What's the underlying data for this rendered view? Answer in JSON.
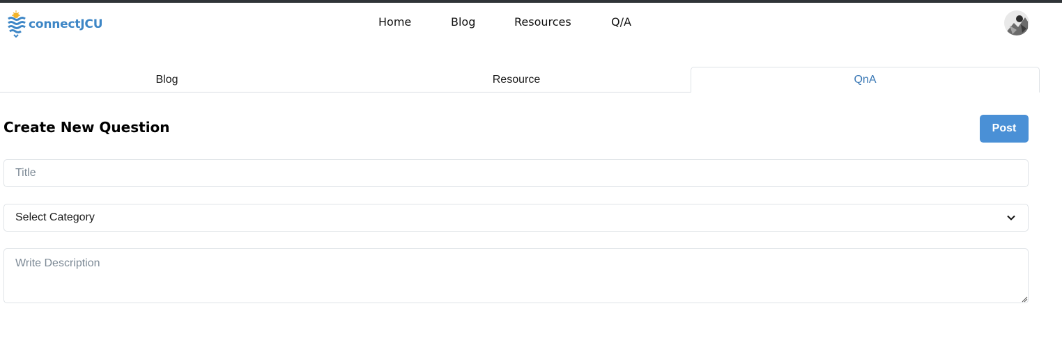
{
  "brand": {
    "name": "connectJCU",
    "accent": "#3d86c6"
  },
  "nav": [
    {
      "label": "Home"
    },
    {
      "label": "Blog"
    },
    {
      "label": "Resources"
    },
    {
      "label": "Q/A"
    }
  ],
  "tabs": [
    {
      "label": "Blog",
      "active": false
    },
    {
      "label": "Resource",
      "active": false
    },
    {
      "label": "QnA",
      "active": true
    }
  ],
  "form": {
    "heading": "Create New Question",
    "post_label": "Post",
    "title_placeholder": "Title",
    "category_selected": "Select Category",
    "description_placeholder": "Write Description"
  },
  "colors": {
    "post_button": "#4a90d6",
    "active_tab_text": "#3a78b5"
  }
}
